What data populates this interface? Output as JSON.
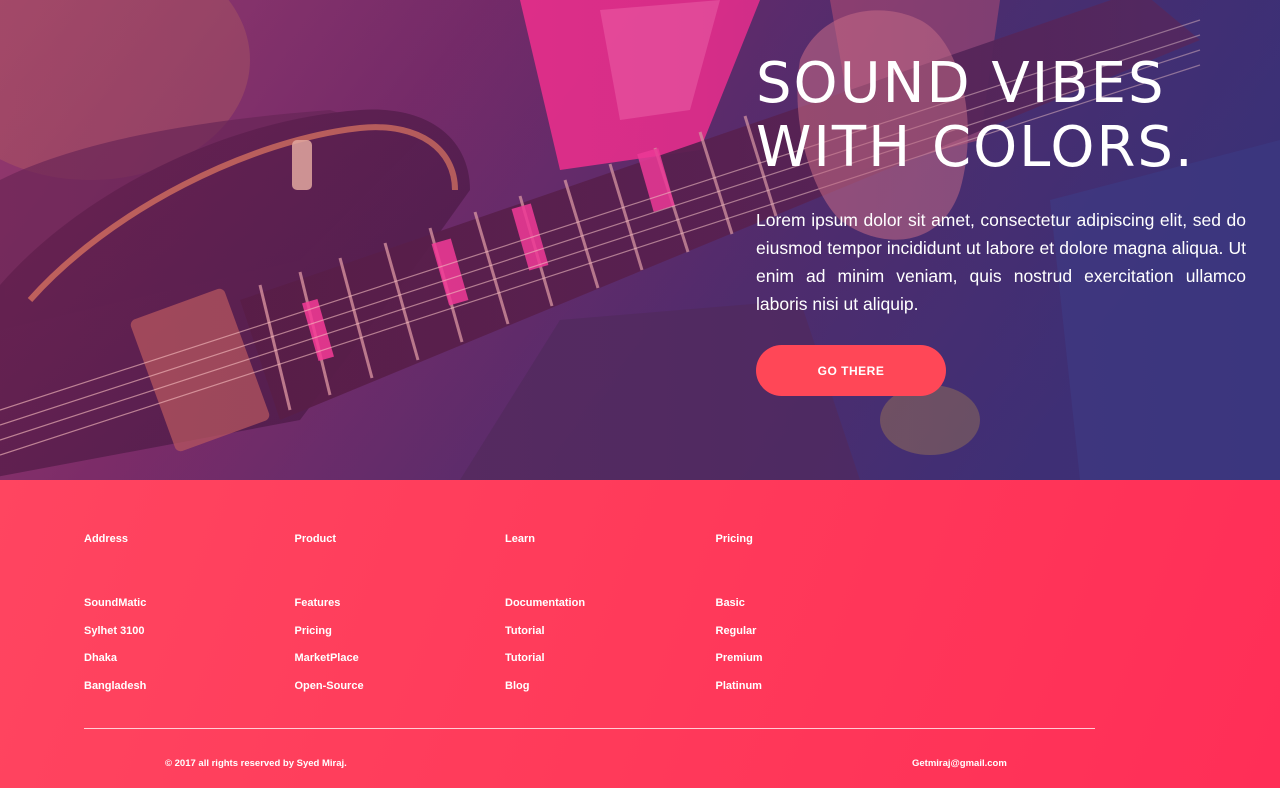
{
  "hero": {
    "title_line1": "SOUND VIBES",
    "title_line2": "WITH COLORS.",
    "description": "Lorem ipsum dolor sit amet, consectetur adipiscing elit, sed do eiusmod tempor incididunt ut labore et dolore magna aliqua. Ut enim ad minim veniam, quis nostrud exercitation ullamco laboris nisi ut aliquip.",
    "button_label": "GO THERE",
    "background_image": "guitar-player-photo",
    "accent_color": "#ff4757"
  },
  "footer": {
    "background_color": "#ff3b5c",
    "columns": [
      {
        "heading": "Address",
        "items": [
          "SoundMatic",
          "Sylhet 3100",
          "Dhaka",
          "Bangladesh"
        ]
      },
      {
        "heading": "Product",
        "items": [
          "Features",
          "Pricing",
          "MarketPlace",
          "Open-Source"
        ]
      },
      {
        "heading": "Learn",
        "items": [
          "Documentation",
          "Tutorial",
          "Tutorial",
          "Blog"
        ]
      },
      {
        "heading": "Pricing",
        "items": [
          "Basic",
          "Regular",
          "Premium",
          "Platinum"
        ]
      }
    ],
    "copyright": "© 2017 all rights reserved by Syed Miraj.",
    "email": "Getmiraj@gmail.com"
  }
}
